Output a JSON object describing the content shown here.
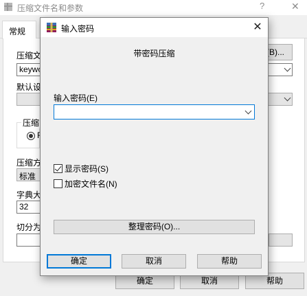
{
  "background_window": {
    "title": "压缩文件名和参数",
    "help_glyph": "?",
    "close_glyph": "✕",
    "tab_general": "常规",
    "archive_name_label": "压缩文",
    "browse_button": "(B)...",
    "archive_name_value": "keywo",
    "default_settings_label": "默认设",
    "format_group_label": "压缩",
    "format_radio_label": "R",
    "method_label": "压缩方",
    "method_value": "标准",
    "dictionary_label": "字典大",
    "dictionary_value": "32",
    "split_label": "切分为",
    "ok_button": "确定",
    "cancel_button": "取消",
    "help_button": "帮助"
  },
  "dialog": {
    "title": "输入密码",
    "subtitle": "带密码压缩",
    "password_label": "输入密码(E)",
    "password_value": "",
    "show_password": {
      "label": "显示密码(S)",
      "checked": true
    },
    "encrypt_filenames": {
      "label": "加密文件名(N)",
      "checked": false
    },
    "organize_button": "整理密码(O)...",
    "ok_button": "确定",
    "cancel_button": "取消",
    "help_button": "帮助",
    "close_glyph": "✕"
  },
  "colors": {
    "accent": "#0078d7",
    "window_bg": "#f0f0f0",
    "button_bg": "#e1e1e1"
  }
}
